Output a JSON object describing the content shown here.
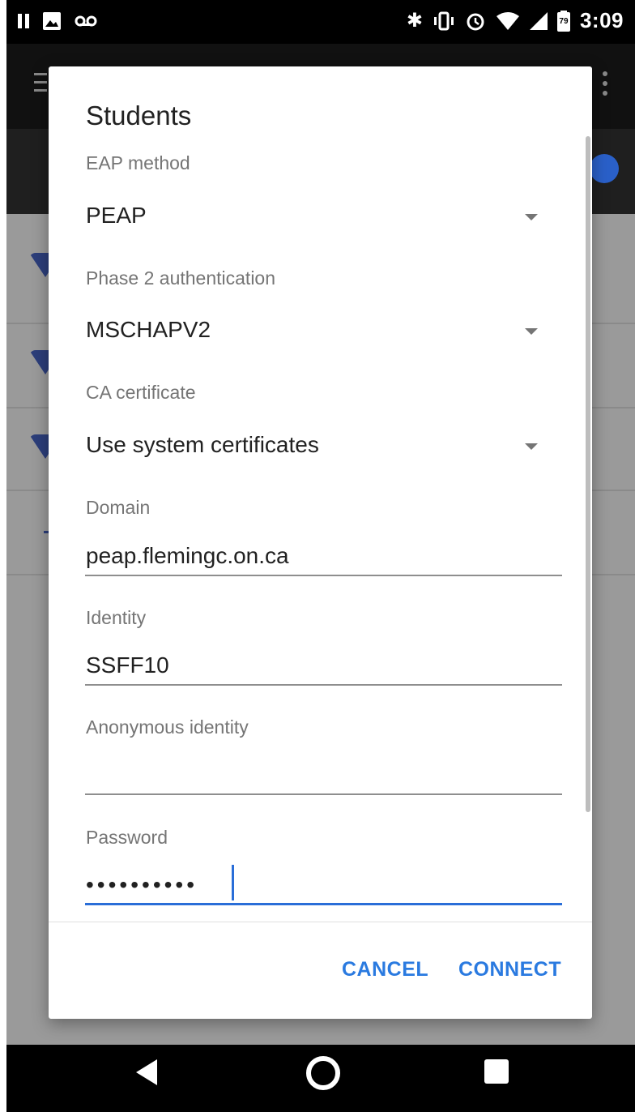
{
  "status_bar": {
    "time": "3:09",
    "battery_level": "79",
    "left_icons": [
      "pause-icon",
      "image-icon",
      "voicemail-icon"
    ],
    "right_icons": [
      "bluetooth-icon",
      "vibrate-icon",
      "alarm-icon",
      "wifi-icon",
      "cell-signal-icon",
      "battery-icon"
    ]
  },
  "dialog": {
    "title": "Students",
    "fields": {
      "eap_method": {
        "label": "EAP method",
        "value": "PEAP"
      },
      "phase2": {
        "label": "Phase 2 authentication",
        "value": "MSCHAPV2"
      },
      "ca_cert": {
        "label": "CA certificate",
        "value": "Use system certificates"
      },
      "domain": {
        "label": "Domain",
        "value": "peap.flemingc.on.ca"
      },
      "identity": {
        "label": "Identity",
        "value": "SSFF10"
      },
      "anon_identity": {
        "label": "Anonymous identity",
        "value": ""
      },
      "password": {
        "label": "Password",
        "value": "••••••••••"
      }
    },
    "buttons": {
      "cancel": "CANCEL",
      "connect": "CONNECT"
    }
  },
  "colors": {
    "accent": "#2a7ae0",
    "text_primary": "#212121",
    "text_secondary": "#757575"
  }
}
